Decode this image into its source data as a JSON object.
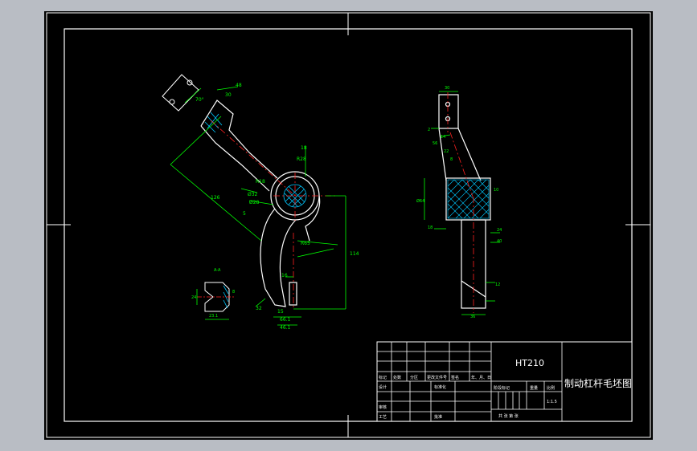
{
  "colors": {
    "app_background": "#b9bdc4",
    "drawing_background": "#000000",
    "outline": "#ffffff",
    "dimension": "#00ff00",
    "hatch": "#00c8ff",
    "centerline": "#ff2020",
    "hidden_line": "#7070ff"
  },
  "material": "HT210",
  "drawing_title": "制动杠杆毛坯图",
  "scale": "1:1.5",
  "title_block": {
    "row_labels": [
      "标记",
      "处数",
      "分区",
      "更改文件号",
      "签名",
      "年、月、日"
    ],
    "designer": "设计",
    "standardization": "标准化",
    "review": "审核",
    "process": "工艺",
    "approval": "批准",
    "stage_mark": "阶段标记",
    "weight": "重量",
    "scale_label": "比例",
    "sheet_info": "共  张  第  张"
  },
  "left_view": {
    "dims": {
      "d48": "48",
      "d30": "30",
      "angle": "70°",
      "d18": "18",
      "r28": "R28",
      "r18": "R18",
      "d32": "Ø32",
      "d28": "Ø28",
      "d126": "126",
      "d5": "5",
      "d65": "R65",
      "d114": "114",
      "d16": "16",
      "d32b": "32",
      "d15": "15",
      "d66": "66.1",
      "d461": "46.1"
    },
    "detail": {
      "label": "A-A",
      "d231": "23.1",
      "d24": "24",
      "d8": "8"
    }
  },
  "right_view": {
    "dims": {
      "d30": "30",
      "d2": "2",
      "d14": "14",
      "d56": "56",
      "d22": "22",
      "d8": "8",
      "d10": "10",
      "d64": "Ø64",
      "d18": "18",
      "d24": "24",
      "d40": "40",
      "d36": "36",
      "d12": "12"
    }
  }
}
